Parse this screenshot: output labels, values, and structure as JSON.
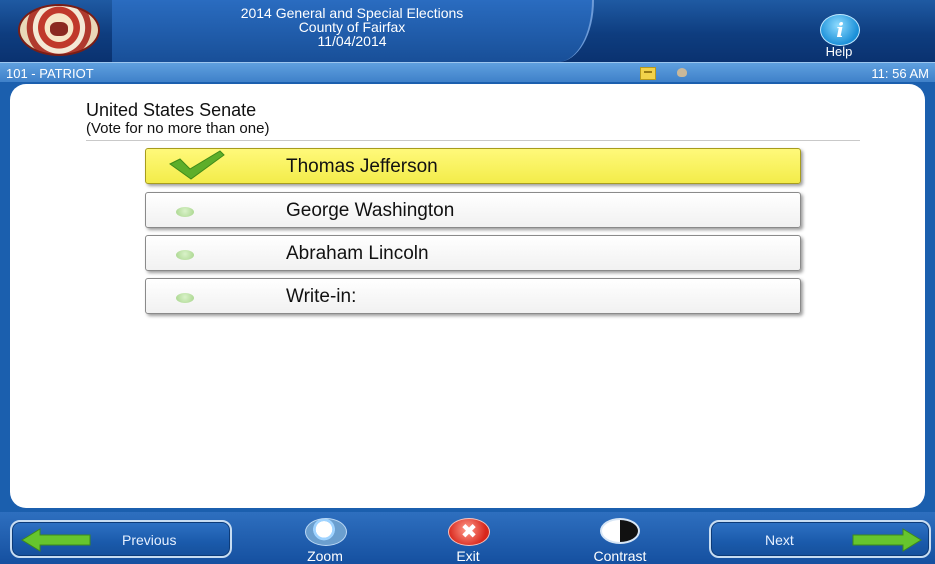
{
  "header": {
    "title_line1": "2014 General and Special Elections",
    "title_line2": "County of Fairfax",
    "title_line3": "11/04/2014",
    "help_label": "Help",
    "help_icon_glyph": "i"
  },
  "status_bar": {
    "precinct": "101 - PATRIOT",
    "time": "11: 56 AM"
  },
  "contest": {
    "title": "United States Senate",
    "instruction": "(Vote for no more than one)",
    "choices": [
      {
        "name": "Thomas Jefferson",
        "selected": true
      },
      {
        "name": "George Washington",
        "selected": false
      },
      {
        "name": "Abraham Lincoln",
        "selected": false
      },
      {
        "name": "Write-in:",
        "selected": false
      }
    ]
  },
  "footer": {
    "previous_label": "Previous",
    "zoom_label": "Zoom",
    "exit_label": "Exit",
    "exit_icon_glyph": "✖",
    "contrast_label": "Contrast",
    "next_label": "Next"
  },
  "colors": {
    "header_blue": "#0e3d7f",
    "status_blue": "#4d8fd4",
    "selected_yellow": "#f7f06a",
    "check_green": "#5dae2a",
    "arrow_green": "#66c52e"
  }
}
